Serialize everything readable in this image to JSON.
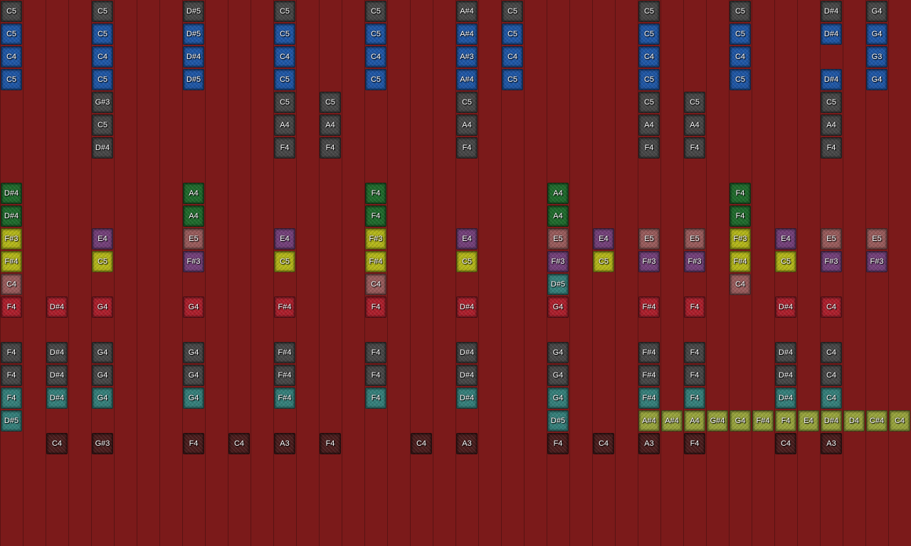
{
  "palette": {
    "gray": "#474747",
    "blue": "#1f57a6",
    "green": "#1f6b2c",
    "yellow": "#b5b81a",
    "pink": "#9a5c5c",
    "purple": "#74407a",
    "red": "#ad1f2c",
    "teal": "#35807b",
    "dark": "#4a1d1d",
    "olive": "#99a53d"
  },
  "rows": [
    {
      "color": "gray",
      "notes": [
        [
          0,
          "C5"
        ],
        [
          4,
          "C5"
        ],
        [
          8,
          "D#5"
        ],
        [
          12,
          "C5"
        ],
        [
          16,
          "C5"
        ],
        [
          20,
          "A#4"
        ],
        [
          22,
          "C5"
        ],
        [
          28,
          "C5"
        ],
        [
          32,
          "C5"
        ],
        [
          36,
          "D#4"
        ],
        [
          38,
          "G4"
        ]
      ]
    },
    {
      "color": "blue",
      "notes": [
        [
          0,
          "C5"
        ],
        [
          4,
          "C5"
        ],
        [
          8,
          "D#5"
        ],
        [
          12,
          "C5"
        ],
        [
          16,
          "C5"
        ],
        [
          20,
          "A#4"
        ],
        [
          22,
          "C5"
        ],
        [
          28,
          "C5"
        ],
        [
          32,
          "C5"
        ],
        [
          36,
          "D#4"
        ],
        [
          38,
          "G4"
        ]
      ]
    },
    {
      "color": "blue",
      "notes": [
        [
          0,
          "C4"
        ],
        [
          4,
          "C4"
        ],
        [
          8,
          "D#4"
        ],
        [
          12,
          "C4"
        ],
        [
          16,
          "C4"
        ],
        [
          20,
          "A#3"
        ],
        [
          22,
          "C4"
        ],
        [
          28,
          "C4"
        ],
        [
          32,
          "C4"
        ],
        [
          38,
          "G3"
        ]
      ]
    },
    {
      "color": "blue",
      "notes": [
        [
          0,
          "C5"
        ],
        [
          4,
          "C5"
        ],
        [
          8,
          "D#5"
        ],
        [
          12,
          "C5"
        ],
        [
          16,
          "C5"
        ],
        [
          20,
          "A#4"
        ],
        [
          22,
          "C5"
        ],
        [
          28,
          "C5"
        ],
        [
          32,
          "C5"
        ],
        [
          36,
          "D#4"
        ],
        [
          38,
          "G4"
        ]
      ]
    },
    {
      "color": "gray",
      "notes": [
        [
          4,
          "G#3"
        ],
        [
          12,
          "C5"
        ],
        [
          14,
          "C5"
        ],
        [
          20,
          "C5"
        ],
        [
          28,
          "C5"
        ],
        [
          30,
          "C5"
        ],
        [
          36,
          "C5"
        ]
      ]
    },
    {
      "color": "gray",
      "notes": [
        [
          4,
          "C5"
        ],
        [
          12,
          "A4"
        ],
        [
          14,
          "A4"
        ],
        [
          20,
          "A4"
        ],
        [
          28,
          "A4"
        ],
        [
          30,
          "A4"
        ],
        [
          36,
          "A4"
        ]
      ]
    },
    {
      "color": "gray",
      "notes": [
        [
          4,
          "D#4"
        ],
        [
          12,
          "F4"
        ],
        [
          14,
          "F4"
        ],
        [
          20,
          "F4"
        ],
        [
          28,
          "F4"
        ],
        [
          30,
          "F4"
        ],
        [
          36,
          "F4"
        ]
      ]
    },
    {
      "color": "green",
      "notes": []
    },
    {
      "color": "green",
      "notes": [
        [
          0,
          "D#4"
        ],
        [
          8,
          "A4"
        ],
        [
          16,
          "F4"
        ],
        [
          24,
          "A4"
        ],
        [
          32,
          "F4"
        ]
      ]
    },
    {
      "color": "green",
      "notes": [
        [
          0,
          "D#4"
        ],
        [
          8,
          "A4"
        ],
        [
          16,
          "F4"
        ],
        [
          24,
          "A4"
        ],
        [
          32,
          "F4"
        ]
      ]
    },
    {
      "color": "mixed",
      "notes": [
        [
          0,
          "F#3",
          "yellow"
        ],
        [
          4,
          "E4",
          "purple"
        ],
        [
          8,
          "E5",
          "pink"
        ],
        [
          12,
          "E4",
          "purple"
        ],
        [
          16,
          "F#3",
          "yellow"
        ],
        [
          20,
          "E4",
          "purple"
        ],
        [
          24,
          "E5",
          "pink"
        ],
        [
          26,
          "E4",
          "purple"
        ],
        [
          28,
          "E5",
          "pink"
        ],
        [
          30,
          "E5",
          "pink"
        ],
        [
          32,
          "F#3",
          "yellow"
        ],
        [
          34,
          "E4",
          "purple"
        ],
        [
          36,
          "E5",
          "pink"
        ],
        [
          38,
          "E5",
          "pink"
        ]
      ]
    },
    {
      "color": "mixed",
      "notes": [
        [
          0,
          "F#4",
          "yellow"
        ],
        [
          4,
          "C5",
          "yellow"
        ],
        [
          8,
          "F#3",
          "purple"
        ],
        [
          12,
          "C5",
          "yellow"
        ],
        [
          16,
          "F#4",
          "yellow"
        ],
        [
          20,
          "C5",
          "yellow"
        ],
        [
          24,
          "F#3",
          "purple"
        ],
        [
          26,
          "C5",
          "yellow"
        ],
        [
          28,
          "F#3",
          "purple"
        ],
        [
          30,
          "F#3",
          "purple"
        ],
        [
          32,
          "F#4",
          "yellow"
        ],
        [
          34,
          "C5",
          "yellow"
        ],
        [
          36,
          "F#3",
          "purple"
        ],
        [
          38,
          "F#3",
          "purple"
        ]
      ]
    },
    {
      "color": "mixed",
      "notes": [
        [
          0,
          "C4",
          "pink"
        ],
        [
          16,
          "C4",
          "pink"
        ],
        [
          24,
          "D#5",
          "teal"
        ],
        [
          32,
          "C4",
          "pink"
        ]
      ]
    },
    {
      "color": "red",
      "notes": [
        [
          0,
          "F4"
        ],
        [
          2,
          "D#4"
        ],
        [
          4,
          "G4"
        ],
        [
          8,
          "G4"
        ],
        [
          12,
          "F#4"
        ],
        [
          16,
          "F4"
        ],
        [
          20,
          "D#4"
        ],
        [
          24,
          "G4"
        ],
        [
          28,
          "F#4"
        ],
        [
          30,
          "F4"
        ],
        [
          34,
          "D#4"
        ],
        [
          36,
          "C4"
        ]
      ]
    },
    {
      "color": "gray",
      "notes": []
    },
    {
      "color": "gray",
      "notes": [
        [
          0,
          "F4"
        ],
        [
          2,
          "D#4"
        ],
        [
          4,
          "G4"
        ],
        [
          8,
          "G4"
        ],
        [
          12,
          "F#4"
        ],
        [
          16,
          "F4"
        ],
        [
          20,
          "D#4"
        ],
        [
          24,
          "G4"
        ],
        [
          28,
          "F#4"
        ],
        [
          30,
          "F4"
        ],
        [
          34,
          "D#4"
        ],
        [
          36,
          "C4"
        ]
      ]
    },
    {
      "color": "gray",
      "notes": [
        [
          0,
          "F4"
        ],
        [
          2,
          "D#4"
        ],
        [
          4,
          "G4"
        ],
        [
          8,
          "G4"
        ],
        [
          12,
          "F#4"
        ],
        [
          16,
          "F4"
        ],
        [
          20,
          "D#4"
        ],
        [
          24,
          "G4"
        ],
        [
          28,
          "F#4"
        ],
        [
          30,
          "F4"
        ],
        [
          34,
          "D#4"
        ],
        [
          36,
          "C4"
        ]
      ]
    },
    {
      "color": "teal",
      "notes": [
        [
          0,
          "F4"
        ],
        [
          2,
          "D#4"
        ],
        [
          4,
          "G4"
        ],
        [
          8,
          "G4"
        ],
        [
          12,
          "F#4"
        ],
        [
          16,
          "F4"
        ],
        [
          20,
          "D#4"
        ],
        [
          24,
          "G4"
        ],
        [
          28,
          "F#4"
        ],
        [
          30,
          "F4"
        ],
        [
          34,
          "D#4"
        ],
        [
          36,
          "C4"
        ]
      ]
    },
    {
      "color": "mixed",
      "notes": [
        [
          0,
          "D#5",
          "teal"
        ],
        [
          24,
          "D#5",
          "teal"
        ],
        [
          28,
          "A#4",
          "olive"
        ],
        [
          29,
          "A#4",
          "olive"
        ],
        [
          30,
          "A4",
          "olive"
        ],
        [
          31,
          "G#4",
          "olive"
        ],
        [
          32,
          "G4",
          "olive"
        ],
        [
          33,
          "F#4",
          "olive"
        ],
        [
          34,
          "F4",
          "olive"
        ],
        [
          35,
          "E4",
          "olive"
        ],
        [
          36,
          "D#4",
          "olive"
        ],
        [
          37,
          "D4",
          "olive"
        ],
        [
          38,
          "C#4",
          "olive"
        ],
        [
          39,
          "C4",
          "olive"
        ]
      ]
    },
    {
      "color": "dark",
      "notes": [
        [
          2,
          "C4"
        ],
        [
          4,
          "G#3"
        ],
        [
          8,
          "F4"
        ],
        [
          10,
          "C4"
        ],
        [
          12,
          "A3"
        ],
        [
          14,
          "F4"
        ],
        [
          18,
          "C4"
        ],
        [
          20,
          "A3"
        ],
        [
          24,
          "F4"
        ],
        [
          26,
          "C4"
        ],
        [
          28,
          "A3"
        ],
        [
          30,
          "F4"
        ],
        [
          34,
          "C4"
        ],
        [
          36,
          "A3"
        ]
      ]
    }
  ]
}
